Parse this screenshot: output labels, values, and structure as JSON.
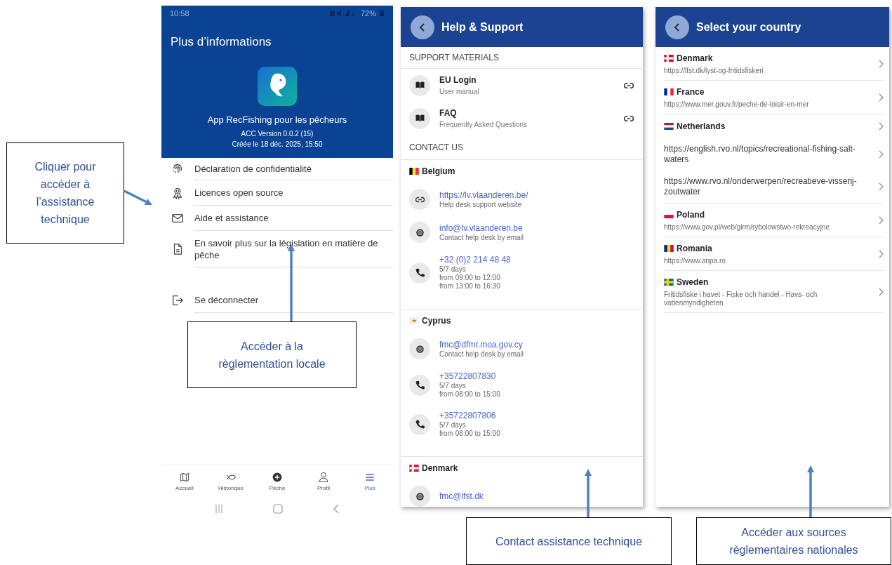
{
  "more_screen": {
    "status_bar": {
      "time": "10:58",
      "battery": "72%"
    },
    "title": "Plus d’informations",
    "app_name": "App RecFishing pour les pêcheurs",
    "version": "ACC Version 0.0.2 (15)",
    "build_date": "Créée le 18 déc. 2025, 15:50",
    "menu": [
      {
        "kind": "privacy",
        "label": "Déclaration de confidentialité"
      },
      {
        "kind": "licenses",
        "label": "Licences open source"
      },
      {
        "kind": "help",
        "label": "Aide et assistance"
      },
      {
        "kind": "legislation",
        "label": "En savoir plus sur la législation en matière de pêche"
      },
      {
        "kind": "logout",
        "label": "Se déconnecter"
      }
    ],
    "bottom_nav": [
      {
        "kind": "map",
        "label": "Accueil",
        "selected": false
      },
      {
        "kind": "fish",
        "label": "Historique",
        "selected": false
      },
      {
        "kind": "add",
        "label": "Pêche",
        "selected": false
      },
      {
        "kind": "profile",
        "label": "Profil",
        "selected": false
      },
      {
        "kind": "menu",
        "label": "Plus",
        "selected": true
      }
    ]
  },
  "help_screen": {
    "title": "Help & Support",
    "support_heading": "SUPPORT MATERIALS",
    "materials": [
      {
        "title": "EU Login",
        "subtitle": "User manual"
      },
      {
        "title": "FAQ",
        "subtitle": "Frequently Asked Questions"
      }
    ],
    "contact_heading": "CONTACT US",
    "countries": [
      {
        "name": "Belgium",
        "flag": {
          "kind": "vertical",
          "stripes": [
            {
              "color": "#000000"
            },
            {
              "color": "#fdda24"
            },
            {
              "color": "#ef3340"
            }
          ]
        },
        "contacts": [
          {
            "kind": "link",
            "value": "https://lv.vlaanderen.be/",
            "details": [
              "Help desk support website"
            ]
          },
          {
            "kind": "email",
            "value": "info@lv.vlaanderen.be",
            "details": [
              "Contact help desk by email"
            ]
          },
          {
            "kind": "phone",
            "value": "+32 (0)2 214 48 48",
            "details": [
              "5/7 days",
              "from 09:00 to 12:00",
              "from 13:00 to 16:30"
            ]
          }
        ]
      },
      {
        "name": "Cyprus",
        "flag": {
          "kind": "emblem",
          "stripes": [
            {
              "color": "#eeeeee"
            },
            {
              "color": "#d57800"
            }
          ]
        },
        "contacts": [
          {
            "kind": "email",
            "value": "fmc@dfmr.moa.gov.cy",
            "details": [
              "Contact help desk by email"
            ]
          },
          {
            "kind": "phone",
            "value": "+35722807830",
            "details": [
              "5/7 days",
              "from 08:00 to 15:00"
            ]
          },
          {
            "kind": "phone",
            "value": "+35722807806",
            "details": [
              "5/7 days",
              "from 08:00 to 15:00"
            ]
          }
        ]
      },
      {
        "name": "Denmark",
        "flag": {
          "kind": "cross",
          "stripes": [
            {
              "color": "#c8102e"
            },
            {
              "color": "#f0e6e6"
            }
          ]
        },
        "contacts": [
          {
            "kind": "email",
            "value": "fmc@lfst.dk"
          }
        ]
      }
    ]
  },
  "country_screen": {
    "title": "Select your country",
    "countries": [
      {
        "name": "Denmark",
        "flag": {
          "kind": "cross",
          "stripes": [
            {
              "color": "#c8102e"
            },
            {
              "color": "#f0e6e6"
            }
          ]
        },
        "links": [
          "https://lfst.dk/lyst-og-fritidsfiskeri"
        ]
      },
      {
        "name": "France",
        "flag": {
          "kind": "vertical",
          "stripes": [
            {
              "color": "#002395"
            },
            {
              "color": "#ffffff"
            },
            {
              "color": "#ed2939"
            }
          ]
        },
        "links": [
          "https://www.mer.gouv.fr/peche-de-loisir-en-mer"
        ]
      },
      {
        "name": "Netherlands",
        "flag": {
          "kind": "horizontal",
          "stripes": [
            {
              "color": "#ae1c28"
            },
            {
              "color": "#ffffff"
            },
            {
              "color": "#21468b"
            }
          ]
        },
        "links": [
          "https://english.rvo.nl/topics/recreational-fishing-salt-waters",
          "https://www.rvo.nl/onderwerpen/recreatieve-visserij-zoutwater"
        ]
      },
      {
        "name": "Poland",
        "flag": {
          "kind": "horizontal",
          "stripes": [
            {
              "color": "#ffffff"
            },
            {
              "color": "#dc143c"
            }
          ]
        },
        "links": [
          "https://www.gov.pl/web/girm/rybolowstwo-rekreacyjne"
        ]
      },
      {
        "name": "Romania",
        "flag": {
          "kind": "vertical",
          "stripes": [
            {
              "color": "#002b7f"
            },
            {
              "color": "#fcd116"
            },
            {
              "color": "#ce1126"
            }
          ]
        },
        "links": [
          "https://www.anpa.ro"
        ]
      },
      {
        "name": "Sweden",
        "flag": {
          "kind": "cross",
          "stripes": [
            {
              "color": "#006aa7"
            },
            {
              "color": "#fecc00"
            }
          ]
        },
        "links": [
          "Fritidsfiske i havet - Fiske och handel - Havs- och vattenmyndigheten"
        ]
      }
    ]
  },
  "callouts": [
    {
      "text": "Cliquer pour accéder à l’assistance technique"
    },
    {
      "text": "Accéder à la règlementation locale"
    },
    {
      "text": "Contact assistance technique"
    },
    {
      "text": "Accéder aux sources règlementaires nationales"
    }
  ]
}
